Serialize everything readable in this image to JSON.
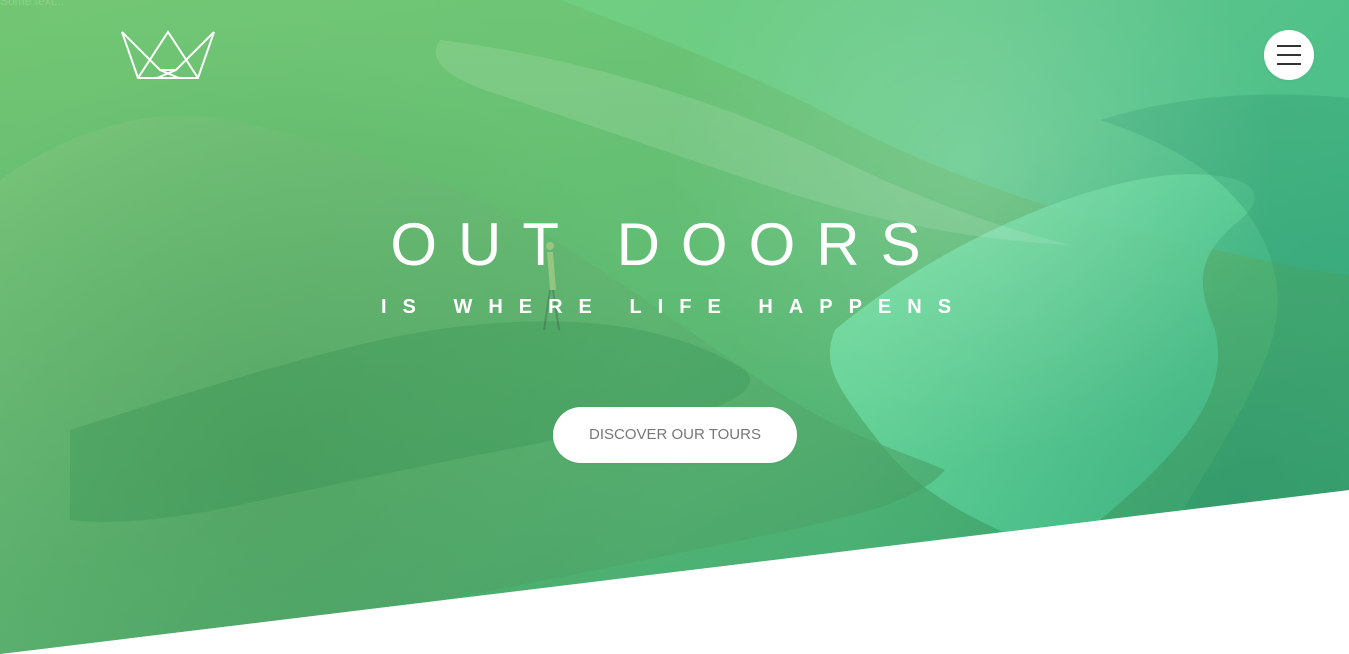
{
  "colors": {
    "hero_green": "#7fd27c",
    "hero_teal": "#34b48b",
    "text_white": "#ffffff",
    "button_text": "#777777",
    "menu_icon": "#333333"
  },
  "header": {
    "logo_icon": "crown-logo-icon",
    "corner_text": "Some text...",
    "menu_icon": "hamburger-menu-icon"
  },
  "hero": {
    "title": "OUT DOORS",
    "subtitle": "IS WHERE LIFE HAPPENS",
    "cta": "DISCOVER OUR TOURS"
  }
}
